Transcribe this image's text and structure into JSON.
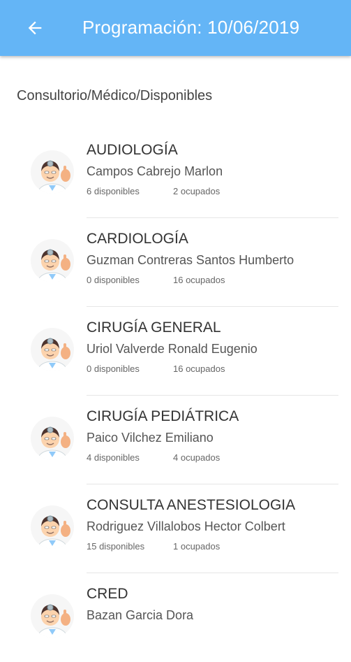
{
  "appbar": {
    "title": "Programación: 10/06/2019"
  },
  "subheader": "Consultorio/Médico/Disponibles",
  "items": [
    {
      "specialty": "AUDIOLOGÍA",
      "doctor": "Campos Cabrejo Marlon",
      "available": "6 disponibles",
      "occupied": "2 ocupados"
    },
    {
      "specialty": "CARDIOLOGÍA",
      "doctor": "Guzman Contreras Santos Humberto",
      "available": "0 disponibles",
      "occupied": "16 ocupados"
    },
    {
      "specialty": "CIRUGÍA GENERAL",
      "doctor": "Uriol Valverde Ronald Eugenio",
      "available": "0 disponibles",
      "occupied": "16 ocupados"
    },
    {
      "specialty": "CIRUGÍA PEDIÁTRICA",
      "doctor": "Paico Vilchez Emiliano",
      "available": "4 disponibles",
      "occupied": "4 ocupados"
    },
    {
      "specialty": "CONSULTA ANESTESIOLOGIA",
      "doctor": "Rodriguez Villalobos Hector Colbert",
      "available": "15 disponibles",
      "occupied": "1 ocupados"
    },
    {
      "specialty": "CRED",
      "doctor": "Bazan Garcia Dora"
    }
  ]
}
